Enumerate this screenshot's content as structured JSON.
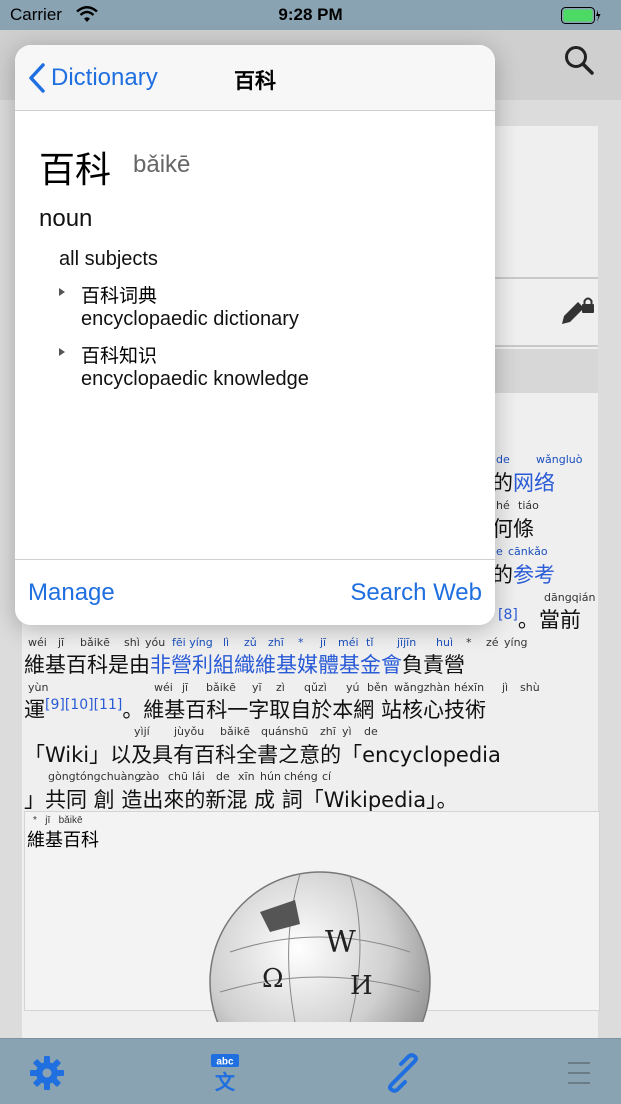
{
  "status_bar": {
    "carrier": "Carrier",
    "time": "9:28 PM"
  },
  "popover": {
    "back_label": "Dictionary",
    "title": "百科",
    "headword": "百科",
    "pinyin": "bǎikē",
    "part_of_speech": "noun",
    "sense": "all subjects",
    "subentries": [
      {
        "hanzi": "百科词典",
        "english": "encyclopaedic dictionary"
      },
      {
        "hanzi": "百科知识",
        "english": "encyclopaedic knowledge"
      }
    ],
    "manage_label": "Manage",
    "search_web_label": "Search Web"
  },
  "article": {
    "line1_py": [
      "de",
      "wǎngluò"
    ],
    "line1_hz": "的",
    "line1_link": "网络",
    "line2_py": [
      "hé",
      "tiáo"
    ],
    "line2_hz": "何條",
    "line3_py": [
      "e",
      "cānkǎo"
    ],
    "line3_hz": "的",
    "line3_link": "参考",
    "line4_py": "dāngqián",
    "line4_sup": "[8]",
    "line4_hz": "。當前",
    "line5_py": [
      "wéi",
      "jī",
      "bǎikē",
      "shì",
      "yóu",
      "fēi yíng",
      "lì",
      "zǔ",
      "zhī",
      "*",
      "jī",
      "méi",
      "tǐ",
      "jījīn",
      "huì",
      "*",
      "zé",
      "yíng"
    ],
    "line5_a": "維基百科是由",
    "line5_link": "非營利組織維基媒體基金會",
    "line5_b": "負責營",
    "line6_py": [
      "yùn",
      "wéi",
      "jī",
      "bǎikē",
      "yī",
      "zì",
      "qǔzì",
      "yú",
      "běn",
      "wǎngzhàn",
      "héxīn",
      "jì",
      "shù"
    ],
    "line6_a": "運",
    "line6_sup": "[9][10][11]",
    "line6_b": "。維基百科一字取自於本網 站核心技術",
    "line7_py": [
      "yìjí",
      "jùyǒu",
      "bǎikē",
      "quánshū",
      "zhī",
      "yì",
      "de"
    ],
    "line7_hz": "「Wiki」以及具有百科全書之意的「encyclopedia",
    "line8_py": [
      "gòngtóngchuàng",
      "zào",
      "chū",
      "lái",
      "de",
      "xīn",
      "hún",
      "chéng",
      "cí"
    ],
    "line8_hz": "」共同 創 造出來的新混 成 詞「Wikipedia」。",
    "figure_py": [
      "*",
      "jī",
      "bǎikē"
    ],
    "figure_title": "維基百科"
  },
  "toolbar": {
    "icons": [
      "gear-icon",
      "dictionary-icon",
      "link-icon",
      "menu-icon"
    ]
  },
  "colors": {
    "accent": "#1f6fe0",
    "bar": "#8aa3b2"
  }
}
